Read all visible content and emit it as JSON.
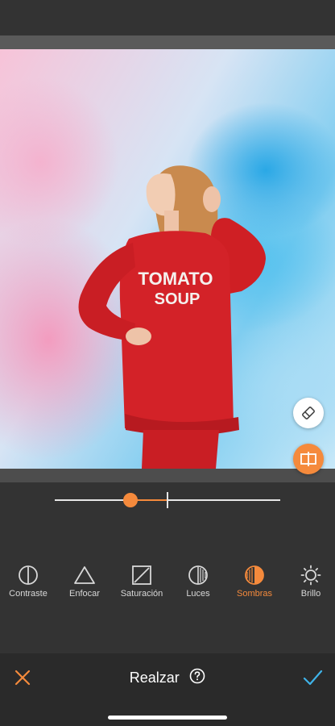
{
  "editor": {
    "slider": {
      "value": -0.33,
      "min": -1,
      "max": 1
    },
    "compare_active": true
  },
  "photo": {
    "sweatshirt_text_line1": "TOMATO",
    "sweatshirt_text_line2": "SOUP"
  },
  "tools": [
    {
      "label": "Contraste",
      "icon": "contrast-icon",
      "active": false
    },
    {
      "label": "Enfocar",
      "icon": "sharpen-icon",
      "active": false
    },
    {
      "label": "Saturación",
      "icon": "saturation-icon",
      "active": false
    },
    {
      "label": "Luces",
      "icon": "highlights-icon",
      "active": false
    },
    {
      "label": "Sombras",
      "icon": "shadows-icon",
      "active": true
    },
    {
      "label": "Brillo",
      "icon": "brightness-icon",
      "active": false
    }
  ],
  "bottom_bar": {
    "title": "Realzar",
    "help_icon": "help-icon",
    "close_icon": "close-icon",
    "confirm_icon": "checkmark-icon"
  },
  "colors": {
    "accent": "#f58a3c",
    "confirm": "#3fb3e8",
    "background": "#333333"
  }
}
